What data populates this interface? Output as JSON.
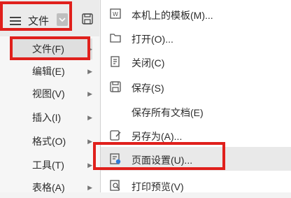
{
  "toolbar": {
    "file_label": "文件"
  },
  "left_menu": {
    "items": [
      {
        "label": "文件(F)"
      },
      {
        "label": "编辑(E)"
      },
      {
        "label": "视图(V)"
      },
      {
        "label": "插入(I)"
      },
      {
        "label": "格式(O)"
      },
      {
        "label": "工具(T)"
      },
      {
        "label": "表格(A)"
      }
    ]
  },
  "right_menu": {
    "items": [
      {
        "label": "本机上的模板(M)..."
      },
      {
        "label": "打开(O)..."
      },
      {
        "label": "关闭(C)"
      },
      {
        "label": "保存(S)"
      },
      {
        "label": "保存所有文档(E)"
      },
      {
        "label": "另存为(A)..."
      },
      {
        "label": "页面设置(U)..."
      },
      {
        "label": "打印预览(V)"
      }
    ]
  },
  "colors": {
    "highlight_red": "#e0201c",
    "accent_blue": "#2f7bd8"
  }
}
